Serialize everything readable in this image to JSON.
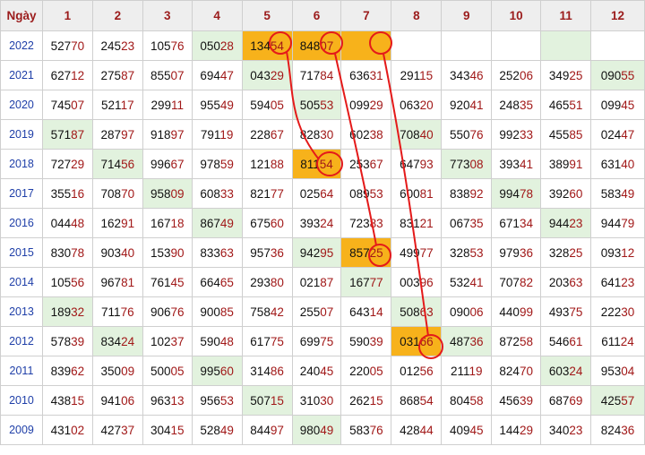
{
  "colors": {
    "header_bg": "#eeeeee",
    "header_text": "#9b1c1c",
    "year_text": "#1f3fa8",
    "tail_text": "#a11818",
    "green_cell": "#e2f2de",
    "orange_cell": "#f7b21b",
    "circle_line": "#e41a1a"
  },
  "table": {
    "header": [
      "Ngày",
      "1",
      "2",
      "3",
      "4",
      "5",
      "6",
      "7",
      "8",
      "9",
      "10",
      "11",
      "12"
    ],
    "rows": [
      {
        "year": "2022",
        "cells": [
          {
            "v": "52770"
          },
          {
            "v": "24523"
          },
          {
            "v": "10576"
          },
          {
            "v": "05028",
            "c": "green"
          },
          {
            "v": "13454",
            "c": "orange"
          },
          {
            "v": "84807",
            "c": "orange"
          },
          {
            "v": "",
            "c": "orange"
          },
          {
            "v": ""
          },
          {
            "v": ""
          },
          {
            "v": ""
          },
          {
            "v": "",
            "c": "green"
          },
          {
            "v": ""
          }
        ]
      },
      {
        "year": "2021",
        "cells": [
          {
            "v": "62712"
          },
          {
            "v": "27587"
          },
          {
            "v": "85507"
          },
          {
            "v": "69447"
          },
          {
            "v": "04329",
            "c": "green"
          },
          {
            "v": "71784"
          },
          {
            "v": "63631"
          },
          {
            "v": "29115"
          },
          {
            "v": "34346"
          },
          {
            "v": "25206"
          },
          {
            "v": "34925"
          },
          {
            "v": "09055",
            "c": "green"
          }
        ]
      },
      {
        "year": "2020",
        "cells": [
          {
            "v": "74507"
          },
          {
            "v": "52117"
          },
          {
            "v": "29911"
          },
          {
            "v": "95549"
          },
          {
            "v": "59405"
          },
          {
            "v": "50553",
            "c": "green"
          },
          {
            "v": "09929"
          },
          {
            "v": "06320"
          },
          {
            "v": "92041"
          },
          {
            "v": "24835"
          },
          {
            "v": "46551"
          },
          {
            "v": "09945"
          }
        ]
      },
      {
        "year": "2019",
        "cells": [
          {
            "v": "57187",
            "c": "green"
          },
          {
            "v": "28797"
          },
          {
            "v": "91897"
          },
          {
            "v": "79119"
          },
          {
            "v": "22867"
          },
          {
            "v": "82830"
          },
          {
            "v": "60238"
          },
          {
            "v": "70840",
            "c": "green"
          },
          {
            "v": "55076"
          },
          {
            "v": "99233"
          },
          {
            "v": "45585"
          },
          {
            "v": "02447"
          }
        ]
      },
      {
        "year": "2018",
        "cells": [
          {
            "v": "72729"
          },
          {
            "v": "71456",
            "c": "green"
          },
          {
            "v": "99667"
          },
          {
            "v": "97859"
          },
          {
            "v": "12188"
          },
          {
            "v": "81154",
            "c": "orange"
          },
          {
            "v": "25367"
          },
          {
            "v": "64793"
          },
          {
            "v": "77308",
            "c": "green"
          },
          {
            "v": "39341"
          },
          {
            "v": "38991"
          },
          {
            "v": "63140"
          }
        ]
      },
      {
        "year": "2017",
        "cells": [
          {
            "v": "35516"
          },
          {
            "v": "70870"
          },
          {
            "v": "95809",
            "c": "green"
          },
          {
            "v": "60833"
          },
          {
            "v": "82177"
          },
          {
            "v": "02564"
          },
          {
            "v": "08953"
          },
          {
            "v": "60081"
          },
          {
            "v": "83892"
          },
          {
            "v": "99478",
            "c": "green"
          },
          {
            "v": "39260"
          },
          {
            "v": "58349"
          }
        ]
      },
      {
        "year": "2016",
        "cells": [
          {
            "v": "04448"
          },
          {
            "v": "16291"
          },
          {
            "v": "16718"
          },
          {
            "v": "86749",
            "c": "green"
          },
          {
            "v": "67560"
          },
          {
            "v": "39324"
          },
          {
            "v": "72383"
          },
          {
            "v": "83121"
          },
          {
            "v": "06735"
          },
          {
            "v": "67134"
          },
          {
            "v": "94423",
            "c": "green"
          },
          {
            "v": "94479"
          }
        ]
      },
      {
        "year": "2015",
        "cells": [
          {
            "v": "83078"
          },
          {
            "v": "90340"
          },
          {
            "v": "15390"
          },
          {
            "v": "83363"
          },
          {
            "v": "95736"
          },
          {
            "v": "94295",
            "c": "green"
          },
          {
            "v": "85725",
            "c": "orange"
          },
          {
            "v": "49977"
          },
          {
            "v": "32853"
          },
          {
            "v": "97936"
          },
          {
            "v": "32825"
          },
          {
            "v": "09312"
          }
        ]
      },
      {
        "year": "2014",
        "cells": [
          {
            "v": "10556"
          },
          {
            "v": "96781"
          },
          {
            "v": "76145"
          },
          {
            "v": "66465"
          },
          {
            "v": "29380"
          },
          {
            "v": "02187"
          },
          {
            "v": "16777",
            "c": "green"
          },
          {
            "v": "00396"
          },
          {
            "v": "53241"
          },
          {
            "v": "70782"
          },
          {
            "v": "20363"
          },
          {
            "v": "64123"
          }
        ]
      },
      {
        "year": "2013",
        "cells": [
          {
            "v": "18932",
            "c": "green"
          },
          {
            "v": "71176"
          },
          {
            "v": "90676"
          },
          {
            "v": "90085"
          },
          {
            "v": "75842"
          },
          {
            "v": "25507"
          },
          {
            "v": "64314"
          },
          {
            "v": "50863",
            "c": "green"
          },
          {
            "v": "09006"
          },
          {
            "v": "44099"
          },
          {
            "v": "49375"
          },
          {
            "v": "22230"
          }
        ]
      },
      {
        "year": "2012",
        "cells": [
          {
            "v": "57839"
          },
          {
            "v": "83424",
            "c": "green"
          },
          {
            "v": "10237"
          },
          {
            "v": "59048"
          },
          {
            "v": "61775"
          },
          {
            "v": "69975"
          },
          {
            "v": "59039"
          },
          {
            "v": "03166",
            "c": "orange"
          },
          {
            "v": "48736",
            "c": "green"
          },
          {
            "v": "87258"
          },
          {
            "v": "54661"
          },
          {
            "v": "61124"
          }
        ]
      },
      {
        "year": "2011",
        "cells": [
          {
            "v": "83962"
          },
          {
            "v": "35009"
          },
          {
            "v": "50005"
          },
          {
            "v": "99560",
            "c": "green"
          },
          {
            "v": "31486"
          },
          {
            "v": "24045"
          },
          {
            "v": "22005"
          },
          {
            "v": "01256"
          },
          {
            "v": "21119"
          },
          {
            "v": "82470"
          },
          {
            "v": "60324",
            "c": "green"
          },
          {
            "v": "95304"
          }
        ]
      },
      {
        "year": "2010",
        "cells": [
          {
            "v": "43815"
          },
          {
            "v": "94106"
          },
          {
            "v": "96313"
          },
          {
            "v": "95653"
          },
          {
            "v": "50715",
            "c": "green"
          },
          {
            "v": "31030"
          },
          {
            "v": "26215"
          },
          {
            "v": "86854"
          },
          {
            "v": "80458"
          },
          {
            "v": "45639"
          },
          {
            "v": "68769"
          },
          {
            "v": "42557",
            "c": "green"
          }
        ]
      },
      {
        "year": "2009",
        "cells": [
          {
            "v": "43102"
          },
          {
            "v": "42737"
          },
          {
            "v": "30415"
          },
          {
            "v": "52849"
          },
          {
            "v": "84497"
          },
          {
            "v": "98049",
            "c": "green"
          },
          {
            "v": "58376"
          },
          {
            "v": "42844"
          },
          {
            "v": "40945"
          },
          {
            "v": "14429"
          },
          {
            "v": "34023"
          },
          {
            "v": "82436"
          }
        ]
      }
    ]
  }
}
